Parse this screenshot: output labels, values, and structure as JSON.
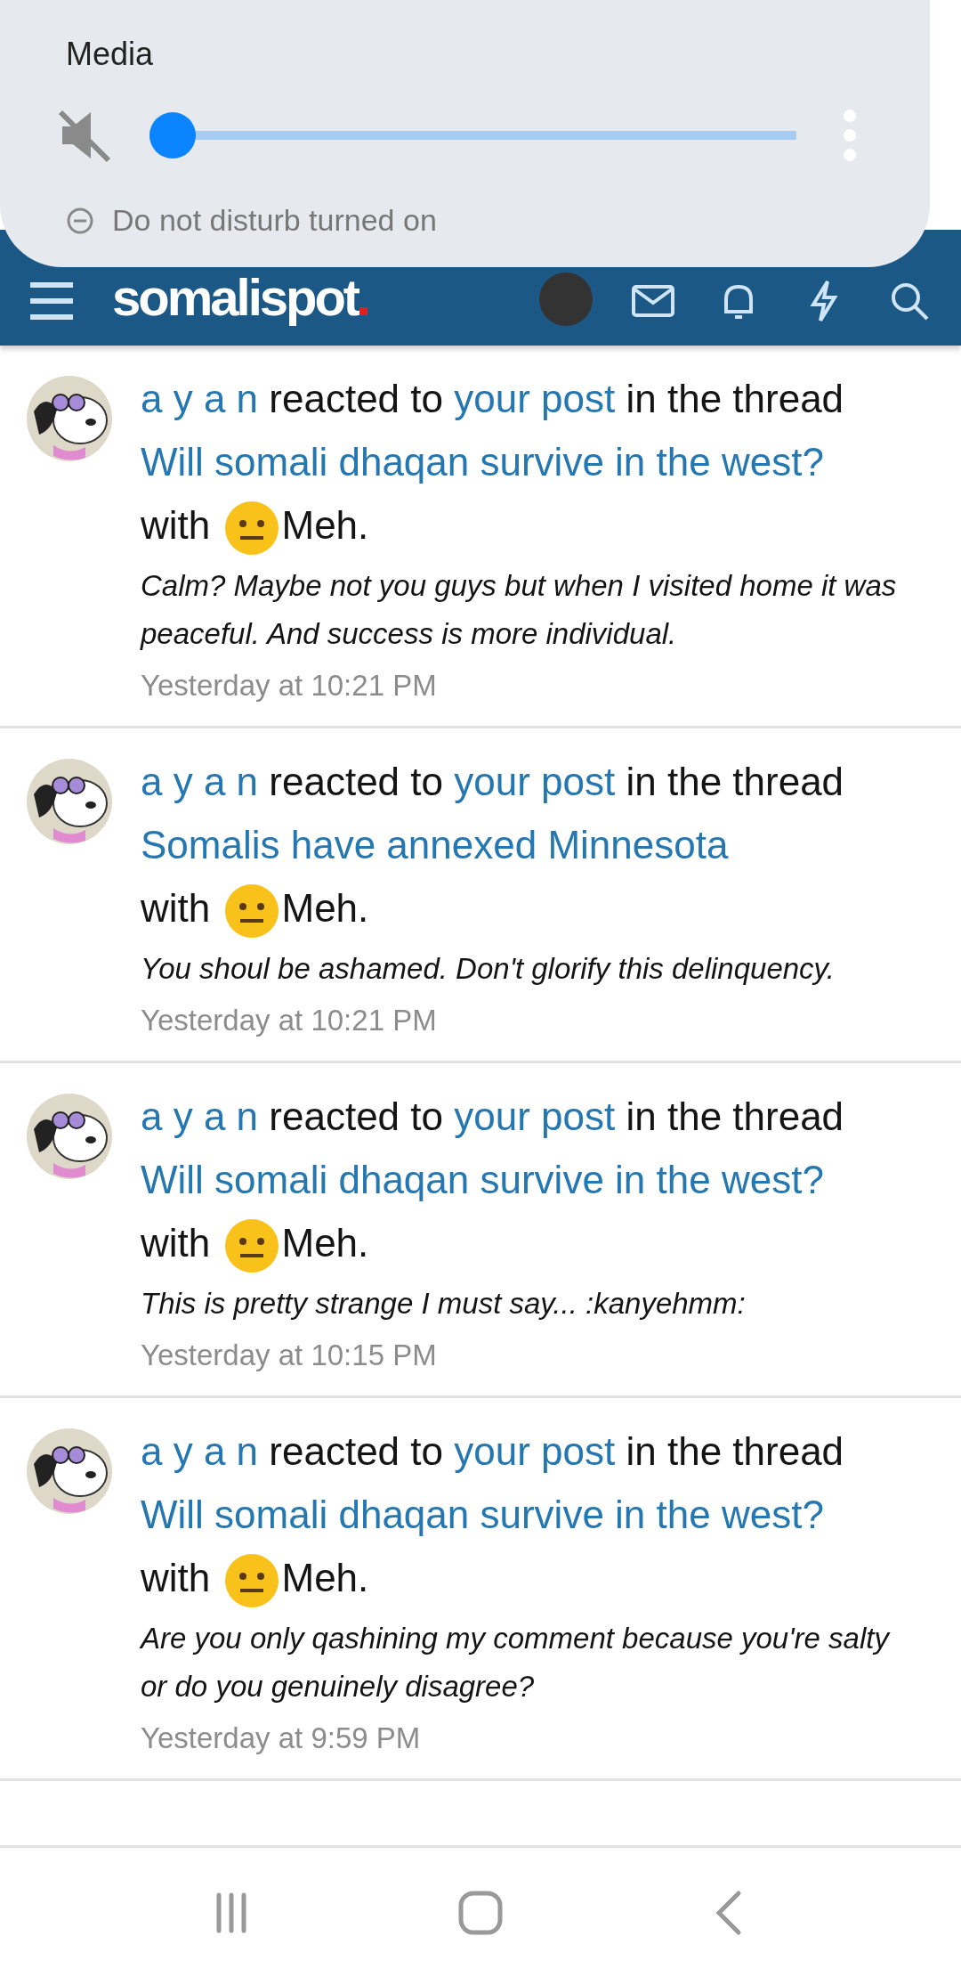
{
  "site_header": {
    "logo": "somalispot"
  },
  "volume_panel": {
    "title": "Media",
    "muted": true,
    "level": 0,
    "notice": "Do not disturb turned on"
  },
  "notifications": [
    {
      "user": "a y a n",
      "verb": "reacted to",
      "target": "your post",
      "connector": "in the thread",
      "thread": "Will somali dhaqan survive in the west?",
      "with": "with",
      "reaction": "Meh.",
      "quote": "Calm? Maybe not you guys but when I visited home it was peaceful. And success is more individual.",
      "time": "Yesterday at 10:21 PM"
    },
    {
      "user": "a y a n",
      "verb": "reacted to",
      "target": "your post",
      "connector": "in the thread",
      "thread": "Somalis have annexed Minnesota",
      "with": "with",
      "reaction": "Meh.",
      "quote": "You shoul be ashamed. Don't glorify this delinquency.",
      "time": "Yesterday at 10:21 PM"
    },
    {
      "user": "a y a n",
      "verb": "reacted to",
      "target": "your post",
      "connector": "in the thread",
      "thread": "Will somali dhaqan survive in the west?",
      "with": "with",
      "reaction": "Meh.",
      "quote": "This is pretty strange I must say... :kanyehmm:",
      "time": "Yesterday at 10:15 PM"
    },
    {
      "user": "a y a n",
      "verb": "reacted to",
      "target": "your post",
      "connector": "in the thread",
      "thread": "Will somali dhaqan survive in the west?",
      "with": "with",
      "reaction": "Meh.",
      "quote": "Are you only qashining my comment because you're salty or do you genuinely disagree?",
      "time": "Yesterday at 9:59 PM"
    }
  ]
}
